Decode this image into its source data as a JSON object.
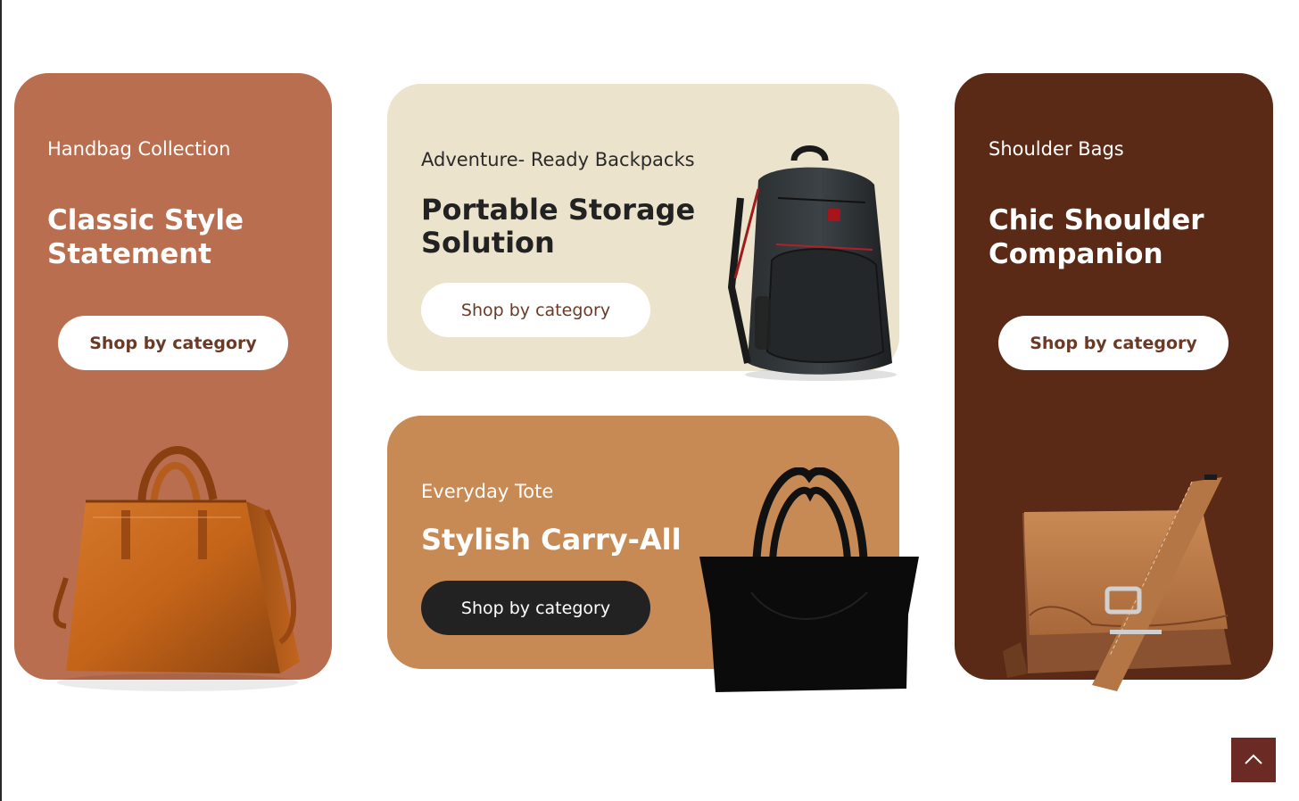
{
  "cards": [
    {
      "eyebrow": "Handbag Collection",
      "title": "Classic Style Statement",
      "cta_label": "Shop by category",
      "background": "#b86e4f",
      "product_icon": "handbag-image"
    },
    {
      "eyebrow": "Adventure- Ready Backpacks",
      "title": "Portable Storage Solution",
      "cta_label": "Shop by category",
      "background": "#ece3cc",
      "product_icon": "backpack-image"
    },
    {
      "eyebrow": "Everyday Tote",
      "title": "Stylish Carry-All",
      "cta_label": "Shop by category",
      "background": "#c88a54",
      "product_icon": "tote-bag-image"
    },
    {
      "eyebrow": "Shoulder Bags",
      "title": "Chic Shoulder Companion",
      "cta_label": "Shop by category",
      "background": "#5a2a16",
      "product_icon": "shoulder-bag-image"
    }
  ],
  "scroll_top": {
    "icon": "chevron-up-icon",
    "color": "#6b2a24"
  }
}
